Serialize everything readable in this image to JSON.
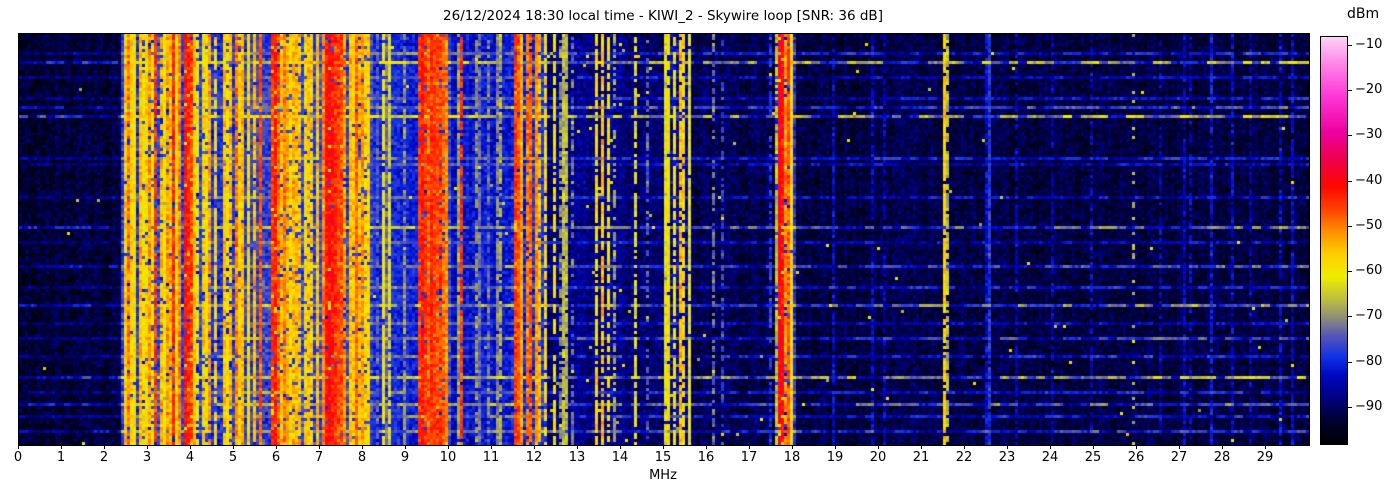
{
  "chart_data": {
    "type": "heatmap",
    "title": "26/12/2024 18:30 local time - KIWI_2 - Skywire loop [SNR: 36 dB]",
    "xlabel": "MHz",
    "x_range": [
      0,
      30
    ],
    "x_ticks": [
      0,
      1,
      2,
      3,
      4,
      5,
      6,
      7,
      8,
      9,
      10,
      11,
      12,
      13,
      14,
      15,
      16,
      17,
      18,
      19,
      20,
      21,
      22,
      23,
      24,
      25,
      26,
      27,
      28,
      29
    ],
    "grid": false,
    "legend": "none",
    "colorbar": {
      "label": "dBm",
      "ticks": [
        -10,
        -20,
        -30,
        -40,
        -50,
        -60,
        -70,
        -80,
        -90
      ],
      "vmax": -8,
      "vmin": -98
    },
    "colormap": [
      [
        -98,
        "#000000"
      ],
      [
        -93,
        "#000030"
      ],
      [
        -88,
        "#000080"
      ],
      [
        -83,
        "#0008c0"
      ],
      [
        -79,
        "#1030e8"
      ],
      [
        -74,
        "#5858b8"
      ],
      [
        -70,
        "#909078"
      ],
      [
        -66,
        "#c0c040"
      ],
      [
        -61,
        "#eeee00"
      ],
      [
        -56,
        "#ffd000"
      ],
      [
        -51,
        "#ff9000"
      ],
      [
        -46,
        "#ff4000"
      ],
      [
        -41,
        "#ff0800"
      ],
      [
        -35,
        "#f0004c"
      ],
      [
        -29,
        "#ee00a0"
      ],
      [
        -21,
        "#ff38d8"
      ],
      [
        -14,
        "#ff85e8"
      ],
      [
        -8,
        "#ffd2f8"
      ]
    ],
    "band_segments": [
      [
        0.0,
        2.35,
        -93,
        0.0,
        -85,
        4,
        3,
        7,
        0.001
      ],
      [
        2.35,
        5.6,
        -78,
        0.45,
        -57,
        12,
        7,
        5,
        0
      ],
      [
        5.6,
        8.2,
        -77,
        0.5,
        -52,
        12,
        7,
        5,
        0
      ],
      [
        8.2,
        9.3,
        -80,
        0.12,
        -62,
        8,
        5,
        5,
        0.004
      ],
      [
        9.3,
        10.05,
        -77,
        0.5,
        -50,
        10,
        7,
        5,
        0
      ],
      [
        10.05,
        11.45,
        -82,
        0.08,
        -70,
        6,
        5,
        5,
        0.004
      ],
      [
        11.45,
        12.3,
        -80,
        0.3,
        -55,
        10,
        7,
        5,
        0
      ],
      [
        12.3,
        13.3,
        -88,
        0.05,
        -68,
        6,
        5,
        6,
        0.012
      ],
      [
        13.3,
        14.05,
        -87,
        0.1,
        -62,
        6,
        5,
        6,
        0.01
      ],
      [
        14.05,
        15.0,
        -89,
        0.04,
        -70,
        6,
        4.5,
        6,
        0.008
      ],
      [
        15.0,
        15.65,
        -85,
        0.22,
        -60,
        8,
        6,
        6,
        0.006
      ],
      [
        15.65,
        17.55,
        -91,
        0.03,
        -80,
        4,
        4,
        6,
        0.004
      ],
      [
        17.55,
        18.05,
        -80,
        0.15,
        -62,
        10,
        6,
        5,
        0
      ],
      [
        18.05,
        30.01,
        -92,
        0.025,
        -82,
        4,
        3.5,
        6,
        0.002
      ]
    ],
    "carriers": [
      [
        2.46,
        -60,
        1,
        0.85
      ],
      [
        2.52,
        -50,
        1,
        0.9
      ],
      [
        2.62,
        -57,
        1,
        0.85
      ],
      [
        2.72,
        -62,
        1,
        0.8
      ],
      [
        2.82,
        -54,
        1,
        0.9
      ],
      [
        2.93,
        -60,
        1,
        0.85
      ],
      [
        3.0,
        -52,
        1,
        0.9
      ],
      [
        3.1,
        -59,
        1,
        0.8
      ],
      [
        3.2,
        -45,
        1,
        0.9
      ],
      [
        3.33,
        -55,
        1,
        0.85
      ],
      [
        3.41,
        -60,
        1,
        0.8
      ],
      [
        3.48,
        -52,
        1,
        0.9
      ],
      [
        3.6,
        -44,
        2,
        0.9
      ],
      [
        3.69,
        -57,
        1,
        0.85
      ],
      [
        3.76,
        -50,
        1,
        0.9
      ],
      [
        3.84,
        -59,
        1,
        0.8
      ],
      [
        3.91,
        -42,
        2,
        0.92
      ],
      [
        3.98,
        -46,
        1,
        0.9
      ],
      [
        4.06,
        -55,
        1,
        0.85
      ],
      [
        4.15,
        -60,
        1,
        0.8
      ],
      [
        4.3,
        -56,
        1,
        0.85
      ],
      [
        4.45,
        -52,
        1,
        0.9
      ],
      [
        4.6,
        -58,
        1,
        0.8
      ],
      [
        4.75,
        -55,
        1,
        0.85
      ],
      [
        4.86,
        -60,
        1,
        0.8
      ],
      [
        4.94,
        -55,
        1,
        0.85
      ],
      [
        5.06,
        -50,
        1,
        0.9
      ],
      [
        5.2,
        -62,
        1,
        0.8
      ],
      [
        5.35,
        -58,
        1,
        0.85
      ],
      [
        5.46,
        -55,
        1,
        0.85
      ],
      [
        5.9,
        -45,
        2,
        0.9
      ],
      [
        5.98,
        -42,
        2,
        0.92
      ],
      [
        6.06,
        -48,
        1,
        0.9
      ],
      [
        6.13,
        -55,
        1,
        0.85
      ],
      [
        6.19,
        -50,
        1,
        0.9
      ],
      [
        6.31,
        -58,
        1,
        0.8
      ],
      [
        6.41,
        -60,
        1,
        0.8
      ],
      [
        6.52,
        -55,
        1,
        0.85
      ],
      [
        6.64,
        -58,
        1,
        0.85
      ],
      [
        6.8,
        -56,
        1,
        0.85
      ],
      [
        6.91,
        -60,
        1,
        0.8
      ],
      [
        7.06,
        -50,
        1,
        0.9
      ],
      [
        7.19,
        -42,
        2,
        0.95
      ],
      [
        7.26,
        -40,
        2,
        0.95
      ],
      [
        7.33,
        -42,
        2,
        0.95
      ],
      [
        7.41,
        -44,
        2,
        0.92
      ],
      [
        7.49,
        -46,
        1,
        0.9
      ],
      [
        7.58,
        -52,
        1,
        0.9
      ],
      [
        7.7,
        -55,
        1,
        0.85
      ],
      [
        7.82,
        -50,
        1,
        0.9
      ],
      [
        7.95,
        -55,
        1,
        0.85
      ],
      [
        8.06,
        -58,
        1,
        0.8
      ],
      [
        8.34,
        -74,
        1,
        0.8
      ],
      [
        8.56,
        -72,
        1,
        0.8
      ],
      [
        8.96,
        -70,
        1,
        0.8
      ],
      [
        9.4,
        -42,
        2,
        0.95
      ],
      [
        9.5,
        -45,
        2,
        0.9
      ],
      [
        9.58,
        -48,
        1,
        0.9
      ],
      [
        9.66,
        -44,
        2,
        0.92
      ],
      [
        9.76,
        -50,
        1,
        0.9
      ],
      [
        9.86,
        -46,
        2,
        0.9
      ],
      [
        9.96,
        -55,
        1,
        0.85
      ],
      [
        10.26,
        -45,
        1,
        0.9
      ],
      [
        10.62,
        -70,
        1,
        0.7
      ],
      [
        10.95,
        -72,
        1,
        0.7
      ],
      [
        11.17,
        -68,
        1,
        0.7
      ],
      [
        11.6,
        -45,
        2,
        0.9
      ],
      [
        11.71,
        -55,
        1,
        0.85
      ],
      [
        11.81,
        -50,
        1,
        0.9
      ],
      [
        11.91,
        -48,
        1,
        0.9
      ],
      [
        12.02,
        -52,
        1,
        0.85
      ],
      [
        12.12,
        -55,
        1,
        0.85
      ],
      [
        12.21,
        -58,
        1,
        0.8
      ],
      [
        12.46,
        -60,
        1,
        0.75
      ],
      [
        12.57,
        -70,
        1,
        0.6
      ],
      [
        12.84,
        -72,
        1,
        0.5
      ],
      [
        13.42,
        -58,
        1,
        0.8
      ],
      [
        13.58,
        -55,
        1,
        0.85
      ],
      [
        13.7,
        -60,
        1,
        0.75
      ],
      [
        13.87,
        -68,
        1,
        0.6
      ],
      [
        14.32,
        -62,
        1,
        0.7
      ],
      [
        14.65,
        -74,
        1,
        0.5
      ],
      [
        15.04,
        -68,
        1,
        0.7
      ],
      [
        15.21,
        -60,
        1,
        0.8
      ],
      [
        15.36,
        -55,
        1,
        0.85
      ],
      [
        15.47,
        -58,
        1,
        0.8
      ],
      [
        15.57,
        -62,
        1,
        0.75
      ],
      [
        16.12,
        -72,
        1,
        0.5
      ],
      [
        16.38,
        -76,
        1,
        0.5
      ],
      [
        17.5,
        -78,
        1,
        0.6
      ],
      [
        17.64,
        -66,
        1,
        0.8
      ],
      [
        17.73,
        -39,
        2,
        0.95
      ],
      [
        17.8,
        -52,
        1,
        0.9
      ],
      [
        17.87,
        -47,
        1,
        0.9
      ],
      [
        17.94,
        -58,
        1,
        0.8
      ],
      [
        18.92,
        -83,
        1,
        0.8
      ],
      [
        19.82,
        -84,
        1,
        0.8
      ],
      [
        20.12,
        -85,
        1,
        0.7
      ],
      [
        21.53,
        -57,
        1,
        0.92
      ],
      [
        21.59,
        -66,
        1,
        0.8
      ],
      [
        22.56,
        -78,
        1,
        0.85
      ],
      [
        23.22,
        -84,
        1,
        0.7
      ],
      [
        24.02,
        -85,
        1,
        0.7
      ],
      [
        24.92,
        -84,
        1,
        0.7
      ],
      [
        25.95,
        -66,
        1,
        0.15
      ],
      [
        26.52,
        -85,
        1,
        0.7
      ],
      [
        27.25,
        -84,
        1,
        0.7
      ],
      [
        28.22,
        -83,
        1,
        0.75
      ],
      [
        28.65,
        -85,
        1,
        0.7
      ],
      [
        29.35,
        -83,
        1,
        0.75
      ]
    ],
    "streak_rows": [
      [
        0.045,
        8
      ],
      [
        0.068,
        15
      ],
      [
        0.105,
        6
      ],
      [
        0.155,
        7
      ],
      [
        0.175,
        10
      ],
      [
        0.195,
        16
      ],
      [
        0.3,
        8
      ],
      [
        0.318,
        6
      ],
      [
        0.4,
        7
      ],
      [
        0.47,
        12
      ],
      [
        0.505,
        6
      ],
      [
        0.565,
        10
      ],
      [
        0.615,
        8
      ],
      [
        0.665,
        13
      ],
      [
        0.705,
        6
      ],
      [
        0.745,
        10
      ],
      [
        0.79,
        8
      ],
      [
        0.835,
        15
      ],
      [
        0.872,
        8
      ],
      [
        0.905,
        12
      ],
      [
        0.937,
        8
      ],
      [
        0.968,
        10
      ]
    ]
  }
}
